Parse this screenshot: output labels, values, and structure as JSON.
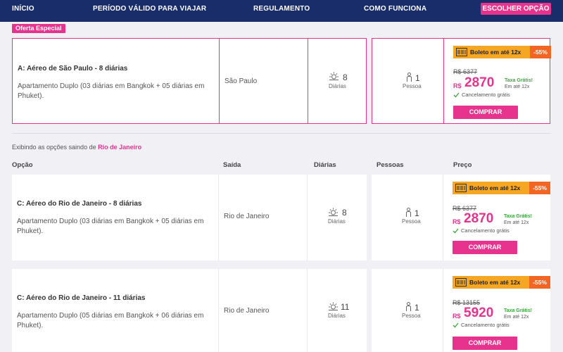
{
  "nav": {
    "items": [
      "INÍCIO",
      "PERÍODO VÁLIDO PARA VIAJAR",
      "REGULAMENTO",
      "COMO FUNCIONA"
    ],
    "cta": "ESCOLHER OPÇÃO"
  },
  "special": {
    "badge": "Oferta Especial",
    "title": "A: Aéreo de São Paulo - 8 diárias",
    "description": "Apartamento Duplo (03 diárias em Bangkok + 05 diárias em Phuket).",
    "departure": "São Paulo",
    "nights": "8",
    "nights_label": "Diárias",
    "people": "1",
    "people_label": "Pessoa",
    "boleto_label": "Boleto em até 12x",
    "discount": "-55%",
    "old_price": "R$ 6377",
    "currency": "R$",
    "price": "2870",
    "tax_free": "Taxa Grátis!",
    "installments": "Em até 12x",
    "cancel": "Cancelamento grátis",
    "buy": "COMPRAR"
  },
  "listing": {
    "prefix": "Exibindo as opções saindo de",
    "city": "Rio de Janeiro",
    "headers": [
      "Opção",
      "Saída",
      "Diárias",
      "Pessoas",
      "Preço"
    ]
  },
  "options": [
    {
      "title": "C: Aéreo do Rio de Janeiro - 8 diárias",
      "description": "Apartamento Duplo (03 diárias em Bangkok + 05 diárias em Phuket).",
      "departure": "Rio de Janeiro",
      "nights": "8",
      "nights_label": "Diárias",
      "people": "1",
      "people_label": "Pessoa",
      "boleto_label": "Boleto em até 12x",
      "discount": "-55%",
      "old_price": "R$ 6377",
      "currency": "R$",
      "price": "2870",
      "tax_free": "Taxa Grátis!",
      "installments": "Em até 12x",
      "cancel": "Cancelamento grátis",
      "buy": "COMPRAR"
    },
    {
      "title": "C: Aéreo do Rio de Janeiro - 11 diárias",
      "description": "Apartamento Duplo (05 diárias em Bangkok + 06 diárias em Phuket).",
      "departure": "Rio de Janeiro",
      "nights": "11",
      "nights_label": "Diárias",
      "people": "1",
      "people_label": "Pessoa",
      "boleto_label": "Boleto em até 12x",
      "discount": "-55%",
      "old_price": "R$ 13155",
      "currency": "R$",
      "price": "5920",
      "tax_free": "Taxa Grátis!",
      "installments": "Em até 12x",
      "cancel": "Cancelamento grátis",
      "buy": "COMPRAR"
    }
  ],
  "colors": {
    "nav_bg": "#1a2d6b",
    "accent": "#e8338e",
    "boleto_bg": "#f5a623",
    "discount_bg": "#f26522",
    "success": "#3aa63a"
  }
}
